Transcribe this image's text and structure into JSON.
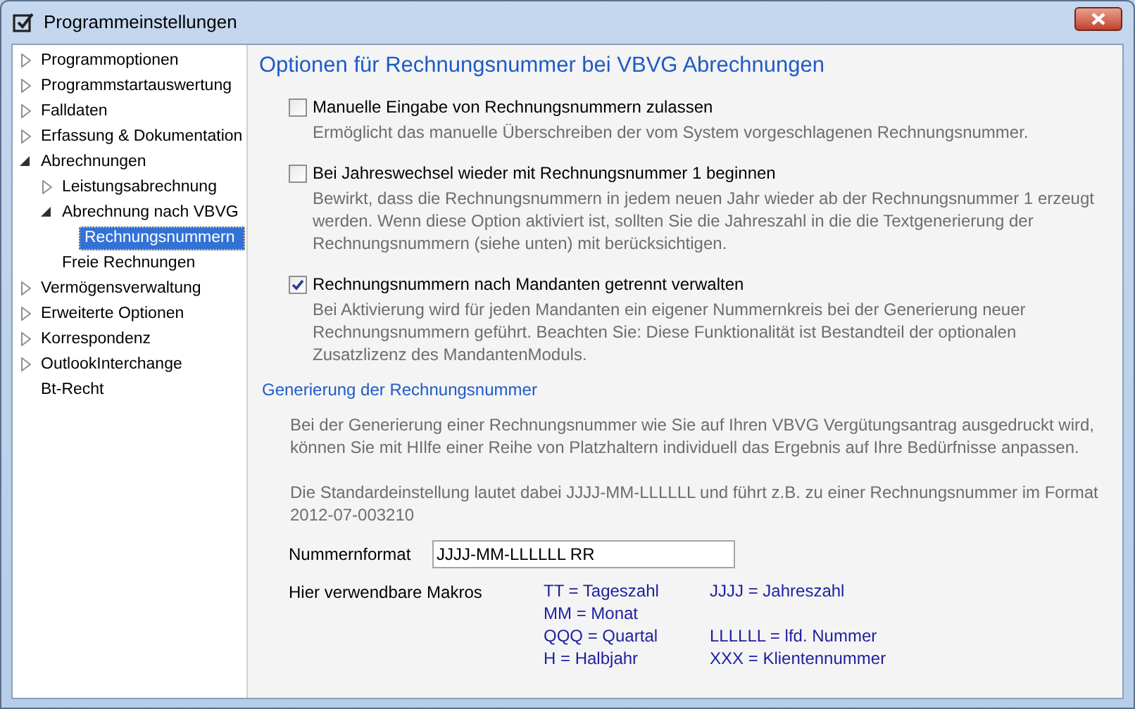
{
  "window": {
    "title": "Programmeinstellungen"
  },
  "tree": [
    {
      "label": "Programmoptionen",
      "expanded": false,
      "selected": false
    },
    {
      "label": "Programmstartauswertung",
      "expanded": false,
      "selected": false
    },
    {
      "label": "Falldaten",
      "expanded": false,
      "selected": false
    },
    {
      "label": "Erfassung & Dokumentation",
      "expanded": false,
      "selected": false
    },
    {
      "label": "Abrechnungen",
      "expanded": true,
      "selected": false,
      "children": [
        {
          "label": "Leistungsabrechnung",
          "expanded": false,
          "selected": false
        },
        {
          "label": "Abrechnung nach VBVG",
          "expanded": true,
          "selected": false,
          "children": [
            {
              "label": "Rechnungsnummern",
              "selected": true
            }
          ]
        },
        {
          "label": "Freie Rechnungen",
          "selected": false
        }
      ]
    },
    {
      "label": "Vermögensverwaltung",
      "expanded": false,
      "selected": false
    },
    {
      "label": "Erweiterte Optionen",
      "expanded": false,
      "selected": false
    },
    {
      "label": "Korrespondenz",
      "expanded": false,
      "selected": false
    },
    {
      "label": "OutlookInterchange",
      "expanded": false,
      "selected": false
    },
    {
      "label": "Bt-Recht",
      "selected": false
    }
  ],
  "heading": "Optionen für Rechnungsnummer bei VBVG Abrechnungen",
  "options": [
    {
      "label": "Manuelle Eingabe von Rechnungsnummern zulassen",
      "checked": false,
      "description": "Ermöglicht das manuelle Überschreiben der vom System vorgeschlagenen Rechnungsnummer."
    },
    {
      "label": "Bei Jahreswechsel wieder mit Rechnungsnummer 1 beginnen",
      "checked": false,
      "description": "Bewirkt, dass die Rechnungsnummern in jedem neuen Jahr wieder ab der Rechnungsnummer 1 erzeugt werden. Wenn diese Option aktiviert ist, sollten Sie die Jahreszahl in die die Textgenerierung der Rechnungsnummern (siehe unten) mit berücksichtigen."
    },
    {
      "label": "Rechnungsnummern nach Mandanten getrennt verwalten",
      "checked": true,
      "description": "Bei Aktivierung wird für jeden Mandanten ein eigener Nummernkreis bei der Generierung neuer Rechnungsnummern geführt. Beachten Sie: Diese Funktionalität ist Bestandteil der optionalen Zusatzlizenz des MandantenModuls."
    }
  ],
  "generation": {
    "heading": "Generierung der Rechnungsnummer",
    "paragraphs": [
      "Bei der Generierung einer Rechnungsnummer wie Sie auf Ihren VBVG Vergütungsantrag ausgedruckt wird, können Sie mit HIlfe einer Reihe von Platzhaltern individuell das Ergebnis auf Ihre Bedürfnisse anpassen.",
      "Die Standardeinstellung lautet dabei JJJJ-MM-LLLLLL und führt z.B. zu einer Rechnungsnummer im Format 2012-07-003210"
    ],
    "format_label": "Nummernformat",
    "format_value": "JJJJ-MM-LLLLLL RR",
    "macros_label": "Hier verwendbare Makros",
    "macros": [
      {
        "left": "TT = Tageszahl",
        "right": "JJJJ = Jahreszahl"
      },
      {
        "left": "MM = Monat"
      },
      {
        "left": "QQQ = Quartal",
        "right": "LLLLLL = lfd. Nummer"
      },
      {
        "left": "H = Halbjahr",
        "right": "XXX = Klientennummer"
      }
    ]
  }
}
